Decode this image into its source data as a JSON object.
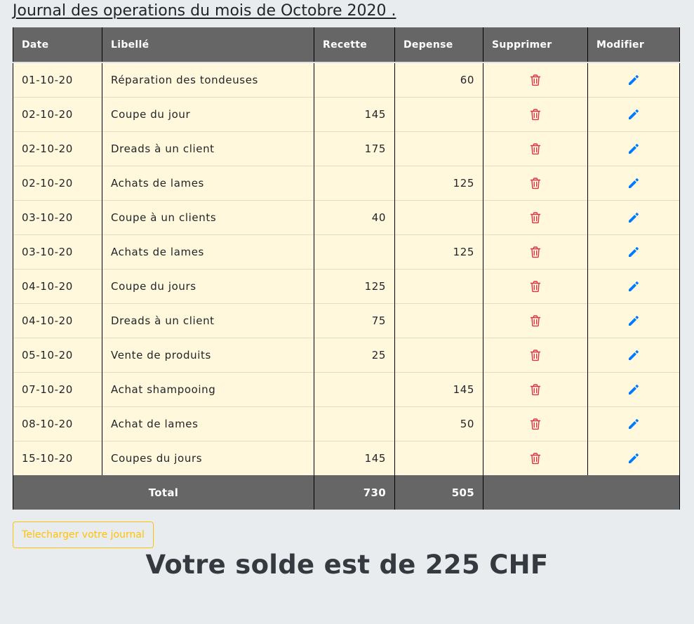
{
  "journal": {
    "title": "Journal des operations du mois de Octobre 2020 ."
  },
  "table": {
    "headers": {
      "date": "Date",
      "libelle": "Libellé",
      "recette": "Recette",
      "depense": "Depense",
      "supprimer": "Supprimer",
      "modifier": "Modifier"
    },
    "rows": [
      {
        "date": "01-10-20",
        "libelle": "Réparation des tondeuses",
        "recette": "",
        "depense": "60"
      },
      {
        "date": "02-10-20",
        "libelle": "Coupe du jour",
        "recette": "145",
        "depense": ""
      },
      {
        "date": "02-10-20",
        "libelle": "Dreads à un client",
        "recette": "175",
        "depense": ""
      },
      {
        "date": "02-10-20",
        "libelle": "Achats de lames",
        "recette": "",
        "depense": "125"
      },
      {
        "date": "03-10-20",
        "libelle": "Coupe à un clients",
        "recette": "40",
        "depense": ""
      },
      {
        "date": "03-10-20",
        "libelle": "Achats de lames",
        "recette": "",
        "depense": "125"
      },
      {
        "date": "04-10-20",
        "libelle": "Coupe du jours",
        "recette": "125",
        "depense": ""
      },
      {
        "date": "04-10-20",
        "libelle": "Dreads à un client",
        "recette": "75",
        "depense": ""
      },
      {
        "date": "05-10-20",
        "libelle": "Vente de produits",
        "recette": "25",
        "depense": ""
      },
      {
        "date": "07-10-20",
        "libelle": "Achat shampooing",
        "recette": "",
        "depense": "145"
      },
      {
        "date": "08-10-20",
        "libelle": "Achat de lames",
        "recette": "",
        "depense": "50"
      },
      {
        "date": "15-10-20",
        "libelle": "Coupes du jours",
        "recette": "145",
        "depense": ""
      }
    ],
    "total": {
      "label": "Total",
      "recette": "730",
      "depense": "505"
    },
    "icons": {
      "delete": "trash-icon",
      "edit": "pencil-icon"
    }
  },
  "download_button": {
    "label": "Telecharger votre journal"
  },
  "balance": {
    "text": "Votre solde est de 225 CHF"
  },
  "colors": {
    "header_bg": "#666666",
    "row_bg": "#fff8dc",
    "page_bg": "#e9ecef",
    "delete_icon": "#dc3545",
    "edit_icon": "#007bff",
    "download_button": "#ffc107"
  }
}
